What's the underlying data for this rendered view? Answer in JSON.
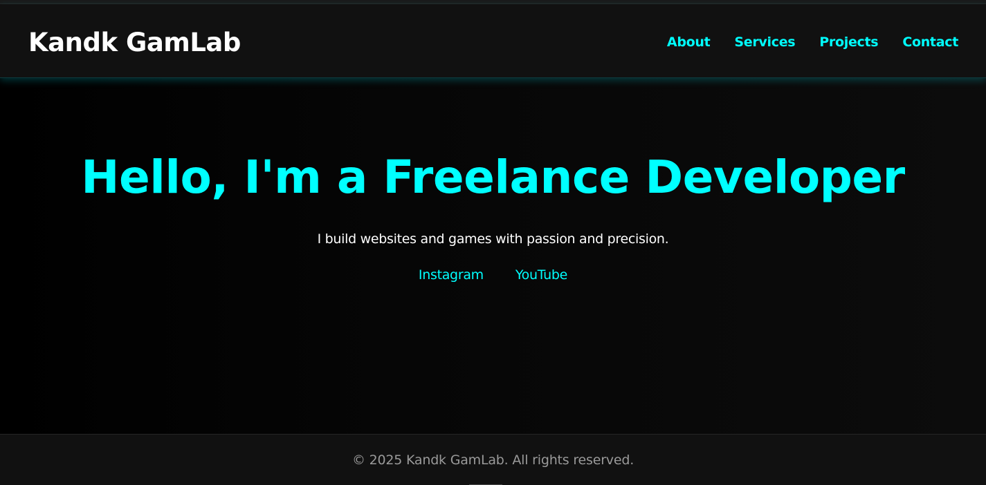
{
  "header": {
    "logo": "Kandk GamLab",
    "nav": [
      {
        "label": "About"
      },
      {
        "label": "Services"
      },
      {
        "label": "Projects"
      },
      {
        "label": "Contact"
      }
    ]
  },
  "hero": {
    "title": "Hello, I'm a Freelance Developer",
    "subtitle": "I build websites and games with passion and precision.",
    "links": [
      {
        "label": "Instagram"
      },
      {
        "label": "YouTube"
      }
    ]
  },
  "footer": {
    "copyright": "© 2025 Kandk GamLab. All rights reserved."
  },
  "colors": {
    "accent": "#00ffff",
    "header_bg": "#111111",
    "footer_text": "#9a9a9a"
  }
}
